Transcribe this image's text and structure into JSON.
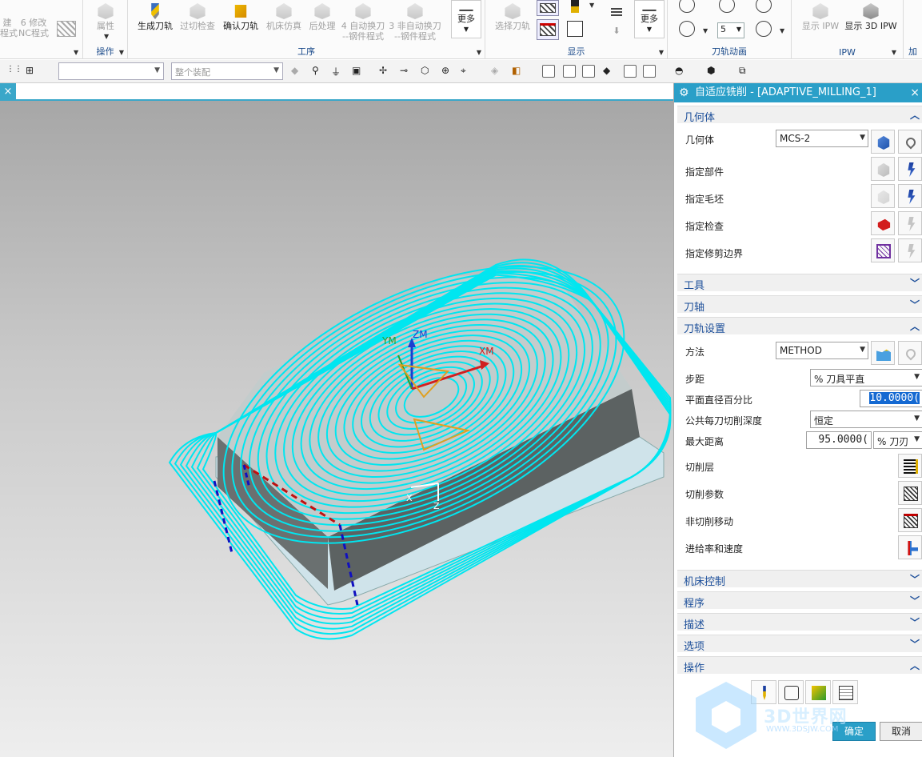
{
  "ribbon": {
    "left_partial": [
      {
        "label": "建",
        "sub": "程式"
      },
      {
        "label": "6 修改",
        "sub": "NC程式"
      }
    ],
    "attr_label": "属性",
    "operate_group": "操作",
    "process_buttons": [
      {
        "label": "生成刀轨",
        "enabled": true
      },
      {
        "label": "过切检查",
        "enabled": false
      },
      {
        "label": "确认刀轨",
        "enabled": true
      },
      {
        "label": "机床仿真",
        "enabled": false
      },
      {
        "label": "后处理",
        "enabled": false
      },
      {
        "label": "4 自动换刀",
        "sub": "--钢件程式",
        "enabled": false
      },
      {
        "label": "3 非自动换刀",
        "sub": "--钢件程式",
        "enabled": false
      }
    ],
    "more_label": "更多",
    "process_group": "工序",
    "select_toolpath": "选择刀轨",
    "display_group": "显示",
    "animation_group": "刀轨动画",
    "anim_speed": "5",
    "ipw_buttons": [
      {
        "label": "显示 IPW",
        "enabled": false
      },
      {
        "label": "显示 3D IPW",
        "enabled": true
      }
    ],
    "ipw_group": "IPW",
    "add_partial": "加"
  },
  "toolbar2": {
    "filter_value": "",
    "assembly_placeholder": "整个装配"
  },
  "tab": {
    "close": "×"
  },
  "viewport": {
    "axis_labels": {
      "ym": "YM",
      "zm": "ZM",
      "xm": "XM",
      "x": "X",
      "z": "Z"
    },
    "colors": {
      "toolpath": "#00e6f0",
      "part_side": "#606868",
      "part_top": "#c8d0d0",
      "floor": "#cfe3ea",
      "engage": "#c01010",
      "retract": "#1010c0"
    }
  },
  "dialog": {
    "title": "自适应铣削 - [ADAPTIVE_MILLING_1]",
    "close": "×",
    "geometry": {
      "header": "几何体",
      "geometry_label": "几何体",
      "geometry_value": "MCS-2",
      "specify_part": "指定部件",
      "specify_blank": "指定毛坯",
      "specify_check": "指定检查",
      "specify_trim": "指定修剪边界"
    },
    "collapsed_1": [
      "工具",
      "刀轴"
    ],
    "toolpath_settings": {
      "header": "刀轨设置",
      "method_label": "方法",
      "method_value": "METHOD",
      "stepover_label": "步距",
      "stepover_value": "% 刀具平直",
      "plane_pct_label": "平面直径百分比",
      "plane_pct_value": "10.0000(",
      "depth_label": "公共每刀切削深度",
      "depth_value": "恒定",
      "maxdist_label": "最大距离",
      "maxdist_value": "95.0000(",
      "maxdist_unit": "% 刀刃",
      "cut_levels": "切削层",
      "cut_params": "切削参数",
      "non_cut_moves": "非切削移动",
      "feeds_speeds": "进给率和速度"
    },
    "collapsed_2": [
      "机床控制",
      "程序",
      "描述",
      "选项"
    ],
    "actions_header": "操作",
    "ok": "确定",
    "cancel": "取消"
  },
  "watermark": {
    "text": "3D世界网",
    "url": "WWW.3DSJW.COM"
  }
}
